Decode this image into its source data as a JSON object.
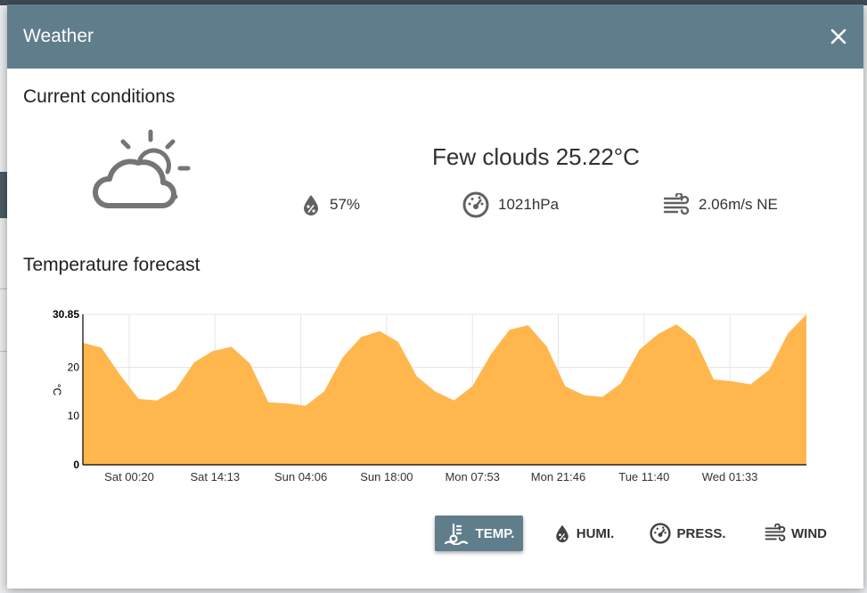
{
  "dialog": {
    "title": "Weather",
    "close_icon": "close-icon"
  },
  "current": {
    "section_title": "Current conditions",
    "icon": "partly-cloudy-icon",
    "description": "Few clouds 25.22°C",
    "humidity": "57%",
    "pressure": "1021hPa",
    "wind": "2.06m/s NE"
  },
  "forecast": {
    "section_title": "Temperature forecast"
  },
  "chart_data": {
    "type": "area",
    "ylabel": "°C",
    "ylim": [
      0,
      30.85
    ],
    "yticks": [
      "30.85",
      "20",
      "10",
      "0"
    ],
    "xticks": [
      "Sat 00:20",
      "Sat 14:13",
      "Sun 04:06",
      "Sun 18:00",
      "Mon 07:53",
      "Mon 21:46",
      "Tue 11:40",
      "Wed 01:33"
    ],
    "fill_color": "#ffb74d",
    "grid": true,
    "values": [
      25,
      24,
      18.5,
      13.5,
      13.2,
      15.4,
      21,
      23.3,
      24.2,
      20.8,
      12.8,
      12.6,
      12.1,
      15,
      22,
      26.2,
      27.4,
      25.2,
      18.1,
      15,
      13.2,
      16.1,
      22.7,
      27.7,
      28.6,
      24.3,
      16.1,
      14.3,
      13.9,
      16.7,
      23.6,
      26.8,
      28.8,
      25.7,
      17.5,
      17.1,
      16.5,
      19.5,
      26.9,
      30.85
    ]
  },
  "tabs": [
    {
      "label": "TEMP.",
      "icon": "thermometer-icon",
      "active": true
    },
    {
      "label": "HUMI.",
      "icon": "humidity-drop-icon",
      "active": false
    },
    {
      "label": "PRESS.",
      "icon": "gauge-icon",
      "active": false
    },
    {
      "label": "WIND",
      "icon": "wind-icon",
      "active": false
    }
  ],
  "colors": {
    "header": "#607d8b",
    "accent_fill": "#ffb74d",
    "icon_gray": "#757575"
  }
}
